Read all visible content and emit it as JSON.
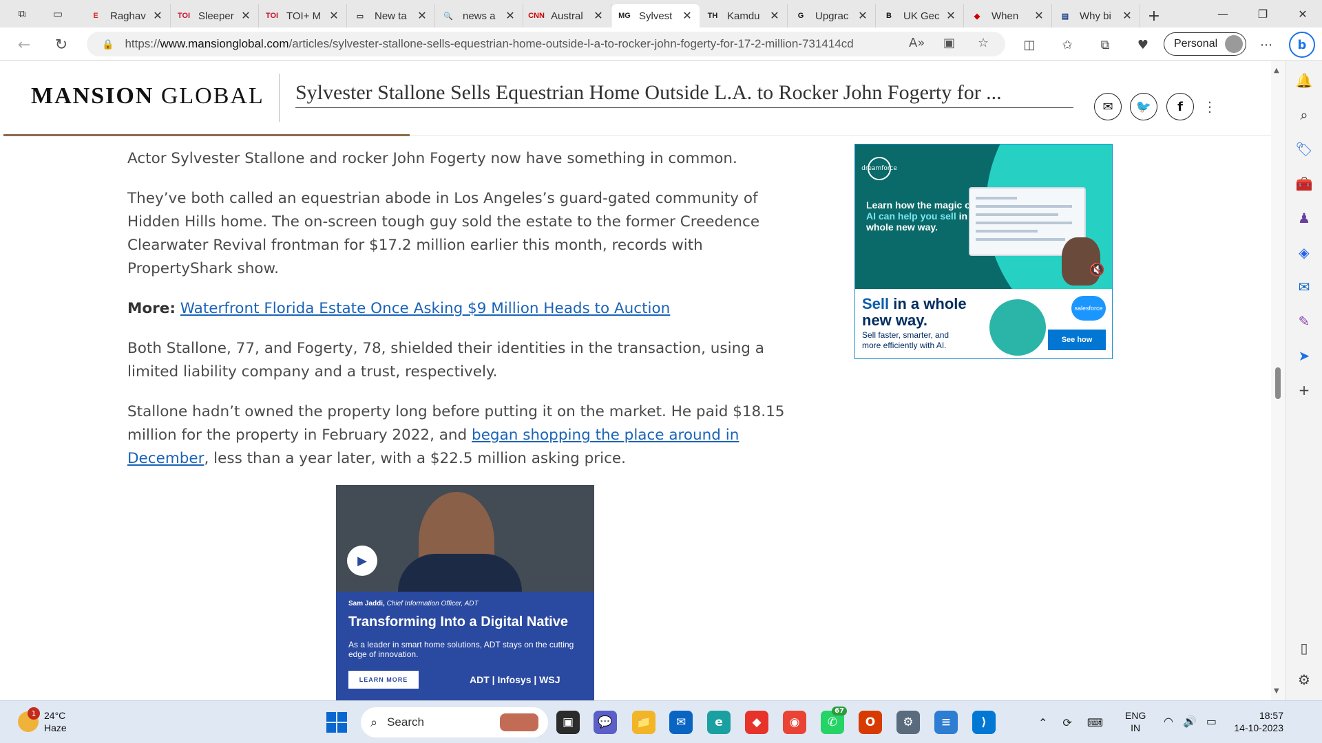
{
  "tabs": [
    {
      "label": "Raghav",
      "fav": "E",
      "fav_color": "#d62828"
    },
    {
      "label": "Sleeper",
      "fav": "TOI",
      "fav_color": "#c8102e"
    },
    {
      "label": "TOI+ M",
      "fav": "TOI",
      "fav_color": "#c8102e"
    },
    {
      "label": "New ta",
      "fav": "▭",
      "fav_color": "#444444"
    },
    {
      "label": "news a",
      "fav": "🔍",
      "fav_color": "#1a73e8"
    },
    {
      "label": "Austral",
      "fav": "CNN",
      "fav_color": "#cc0000"
    },
    {
      "label": "Sylvest",
      "fav": "MG",
      "fav_color": "#222222"
    },
    {
      "label": "Kamdu",
      "fav": "TH",
      "fav_color": "#222222"
    },
    {
      "label": "Upgrac",
      "fav": "G",
      "fav_color": "#111111"
    },
    {
      "label": "UK Gec",
      "fav": "B",
      "fav_color": "#111111"
    },
    {
      "label": "When",
      "fav": "◆",
      "fav_color": "#d10000"
    },
    {
      "label": "Why bi",
      "fav": "▤",
      "fav_color": "#1f3f8a"
    }
  ],
  "address": {
    "prefix": "https://",
    "domain": "www.mansionglobal.com",
    "path": "/articles/sylvester-stallone-sells-equestrian-home-outside-l-a-to-rocker-john-fogerty-for-17-2-million-731414cd"
  },
  "profile_label": "Personal",
  "site": {
    "logo_bold": "MANSION",
    "logo_light": " GLOBAL",
    "headline": "Sylvester Stallone Sells Equestrian Home Outside L.A. to Rocker John Fogerty for ..."
  },
  "article": {
    "p1": "Actor Sylvester Stallone and rocker John Fogerty now have something in common.",
    "p2": "They’ve both called an equestrian abode in Los Angeles’s guard-gated community of Hidden Hills home. The on-screen tough guy sold the estate to the former Creedence Clearwater Revival frontman for $17.2 million earlier this month, records with PropertyShark show.",
    "more_label": "More:",
    "more_link": "Waterfront Florida Estate Once Asking $9 Million Heads to Auction",
    "p3": "Both Stallone, 77, and Fogerty, 78, shielded their identities in the transaction, using a limited liability company and a trust, respectively.",
    "p4_a": "Stallone hadn’t owned the property long before putting it on the market. He paid $18.15 million for the property in February 2022, and ",
    "p4_link": "began shopping the place around in December",
    "p4_b": ", less than a year later, with a $22.5 million asking price."
  },
  "ad_salesforce": {
    "logo": "dreamforce",
    "tag_a": "Learn how the magic of ",
    "tag_hi": "AI can help you sell",
    "tag_b": " in a whole new way.",
    "head_blue": "Sell",
    "head_rest": " in a whole new way.",
    "sub": "Sell faster, smarter, and more efficiently with AI.",
    "brand": "salesforce",
    "cta": "See how"
  },
  "ad_adt": {
    "caption_name": "Sam Jaddi,",
    "caption_role": " Chief Information Officer, ADT",
    "title": "Transforming Into a Digital Native",
    "body": "As a leader in smart home solutions, ADT stays on the cutting edge of innovation.",
    "cta": "LEARN MORE",
    "brands": "ADT | Infosys | WSJ"
  },
  "taskbar": {
    "weather_temp": "24°C",
    "weather_cond": "Haze",
    "weather_badge": "1",
    "search_placeholder": "Search",
    "whatsapp_count": "67",
    "lang_1": "ENG",
    "lang_2": "IN",
    "time": "18:57",
    "date": "14-10-2023"
  }
}
